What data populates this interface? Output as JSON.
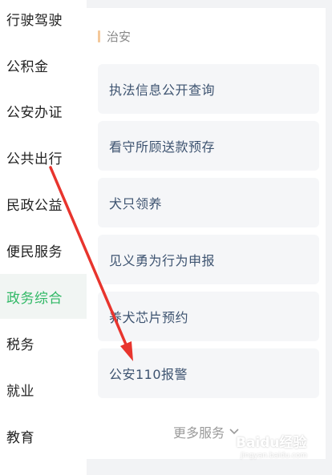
{
  "sidebar": {
    "items": [
      {
        "label": "行驶驾驶"
      },
      {
        "label": "公积金"
      },
      {
        "label": "公安办证"
      },
      {
        "label": "公共出行"
      },
      {
        "label": "民政公益"
      },
      {
        "label": "便民服务"
      },
      {
        "label": "政务综合",
        "active": true
      },
      {
        "label": "税务"
      },
      {
        "label": "就业"
      },
      {
        "label": "教育"
      }
    ],
    "active_color": "#2fb865"
  },
  "section": {
    "title": "治安",
    "accent_color": "#f4c89a",
    "services": [
      {
        "label": "执法信息公开查询"
      },
      {
        "label": "看守所顾送款预存"
      },
      {
        "label": "犬只领养"
      },
      {
        "label": "见义勇为行为申报"
      },
      {
        "label": "养犬芯片预约"
      },
      {
        "label": "公安110报警"
      }
    ]
  },
  "more": {
    "label": "更多服务",
    "icon": "chevron-down-icon"
  },
  "annotation": {
    "color": "#e8342d"
  },
  "watermark": {
    "brand": "Baidu经验",
    "url": "jingyan.baidu.com"
  }
}
